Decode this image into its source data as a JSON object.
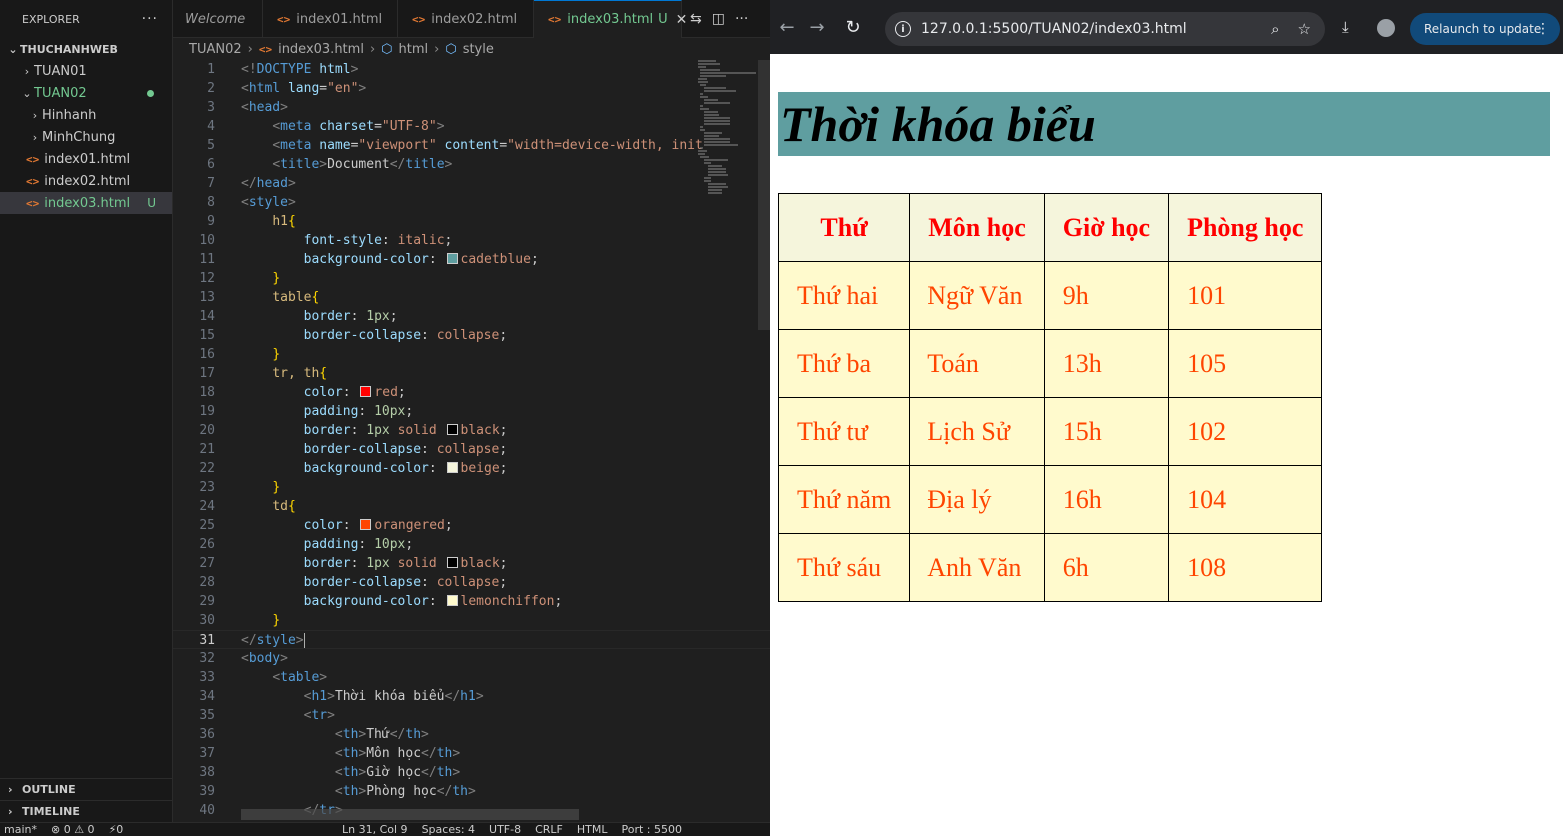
{
  "explorer": {
    "title": "EXPLORER",
    "workspace": "THUCHANHWEB",
    "items": [
      {
        "label": "TUAN01",
        "type": "folder",
        "open": false
      },
      {
        "label": "TUAN02",
        "type": "folder",
        "open": true
      },
      {
        "label": "Hinhanh",
        "type": "folder",
        "open": false
      },
      {
        "label": "MinhChung",
        "type": "folder",
        "open": false
      },
      {
        "label": "index01.html",
        "type": "file"
      },
      {
        "label": "index02.html",
        "type": "file"
      },
      {
        "label": "index03.html",
        "type": "file",
        "status": "U"
      }
    ],
    "outline": "OUTLINE",
    "timeline": "TIMELINE"
  },
  "tabs": [
    {
      "label": "Welcome"
    },
    {
      "label": "index01.html"
    },
    {
      "label": "index02.html"
    },
    {
      "label": "index03.html",
      "status": "U",
      "active": true
    }
  ],
  "breadcrumb": [
    "TUAN02",
    "index03.html",
    "html",
    "style"
  ],
  "editor": {
    "lines": [
      "<!DOCTYPE html>",
      "<html lang=\"en\">",
      "<head>",
      "    <meta charset=\"UTF-8\">",
      "    <meta name=\"viewport\" content=\"width=device-width, init",
      "    <title>Document</title>",
      "</head>",
      "<style>",
      "    h1{",
      "        font-style: italic;",
      "        background-color: cadetblue;",
      "    }",
      "    table{",
      "        border: 1px;",
      "        border-collapse: collapse;",
      "    }",
      "    tr, th{",
      "        color: red;",
      "        padding: 10px;",
      "        border: 1px solid black;",
      "        border-collapse: collapse;",
      "        background-color: beige;",
      "    }",
      "    td{",
      "        color: orangered;",
      "        padding: 10px;",
      "        border: 1px solid black;",
      "        border-collapse: collapse;",
      "        background-color: lemonchiffon;",
      "    }",
      "</style>",
      "<body>",
      "    <table>",
      "        <h1>Thời khóa biểu</h1>",
      "        <tr>",
      "            <th>Thứ</th>",
      "            <th>Môn học</th>",
      "            <th>Giờ học</th>",
      "            <th>Phòng học</th>",
      "        </tr>"
    ],
    "current_line": 31
  },
  "statusbar": {
    "branch": "main*",
    "problems": "⊗ 0 ⚠ 0",
    "ports": "⚡0",
    "position": "Ln 31, Col 9",
    "spaces": "Spaces: 4",
    "encoding": "UTF-8",
    "eol": "CRLF",
    "language": "HTML",
    "port": "Port : 5500"
  },
  "browser": {
    "url": "127.0.0.1:5500/TUAN02/index03.html",
    "relaunch_label": "Relaunch to update",
    "page": {
      "heading": "Thời khóa biểu",
      "table": {
        "headers": [
          "Thứ",
          "Môn học",
          "Giờ học",
          "Phòng học"
        ],
        "rows": [
          [
            "Thứ hai",
            "Ngữ Văn",
            "9h",
            "101"
          ],
          [
            "Thứ ba",
            "Toán",
            "13h",
            "105"
          ],
          [
            "Thứ tư",
            "Lịch Sử",
            "15h",
            "102"
          ],
          [
            "Thứ năm",
            "Địa lý",
            "16h",
            "104"
          ],
          [
            "Thứ sáu",
            "Anh Văn",
            "6h",
            "108"
          ]
        ]
      }
    }
  },
  "colors": {
    "heading_bg": "#5f9ea0",
    "th_color": "#ff0000",
    "th_bg": "#f5f5dc",
    "td_color": "#ff4500",
    "td_bg": "#fffacd",
    "accent": "#0078d4"
  }
}
